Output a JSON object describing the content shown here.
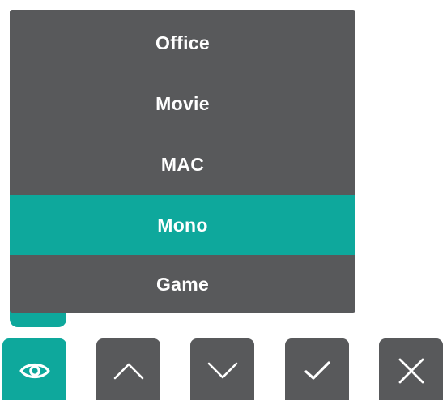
{
  "menu": {
    "items": [
      {
        "label": "Office"
      },
      {
        "label": "Movie"
      },
      {
        "label": "MAC"
      },
      {
        "label": "Mono"
      },
      {
        "label": "Game"
      }
    ],
    "selected_label": "Mono"
  },
  "buttons": [
    {
      "icon": "eye-icon",
      "state": "active"
    },
    {
      "icon": "chevron-up-icon",
      "state": "normal"
    },
    {
      "icon": "chevron-down-icon",
      "state": "normal"
    },
    {
      "icon": "checkmark-icon",
      "state": "normal"
    },
    {
      "icon": "close-icon",
      "state": "normal"
    }
  ],
  "colors": {
    "menu_background": "#58595b",
    "accent": "#0ea89c",
    "text": "#ffffff"
  }
}
